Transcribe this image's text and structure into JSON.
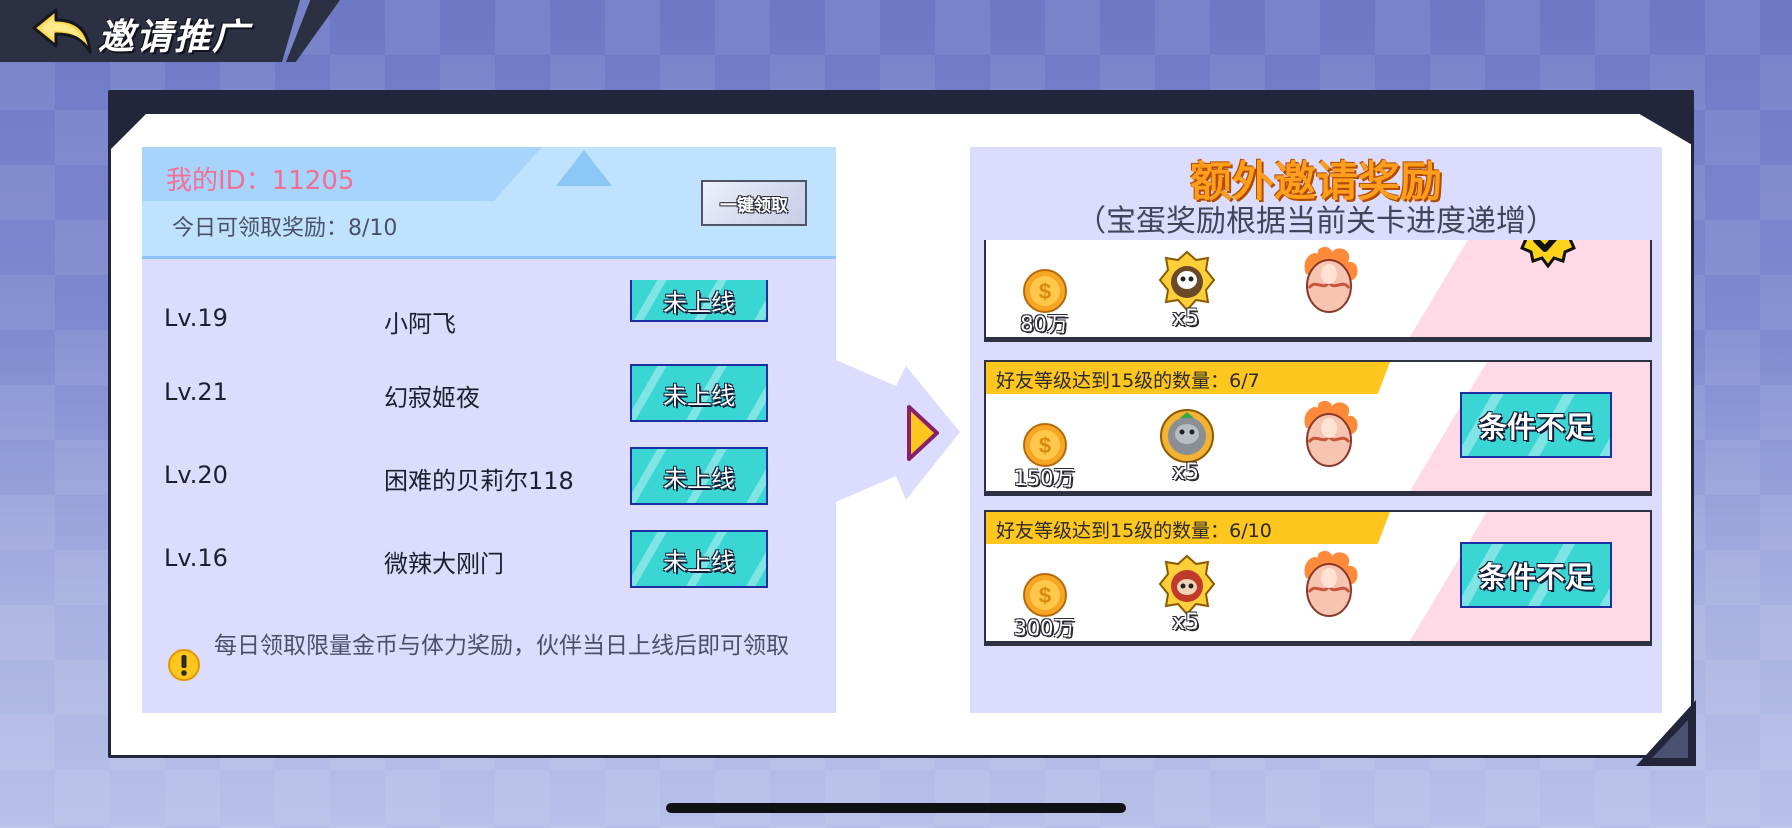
{
  "header": {
    "title": "邀请推广"
  },
  "left": {
    "my_id_label": "我的ID：11205",
    "today_reward": "今日可领取奖励：8/10",
    "claim_all_label": "一键领取",
    "friends": [
      {
        "level": "Lv.19",
        "name": "小阿飞",
        "status": "未上线"
      },
      {
        "level": "Lv.21",
        "name": "幻寂姬夜",
        "status": "未上线"
      },
      {
        "level": "Lv.20",
        "name": "困难的贝莉尔118",
        "status": "未上线"
      },
      {
        "level": "Lv.16",
        "name": "微辣大刚门",
        "status": "未上线"
      }
    ],
    "info_text": "每日领取限量金币与体力奖励，伙伴当日上线后即可领取"
  },
  "right": {
    "title": "额外邀请奖励",
    "subtitle": "（宝蛋奖励根据当前关卡进度递增）",
    "rewards": [
      {
        "requirement": "",
        "coins": "80万",
        "pet_count": "x5",
        "status": "claimed",
        "status_icon": "check-badge-icon"
      },
      {
        "requirement": "好友等级达到15级的数量：6/7",
        "coins": "150万",
        "pet_count": "x5",
        "status_label": "条件不足"
      },
      {
        "requirement": "好友等级达到15级的数量：6/10",
        "coins": "300万",
        "pet_count": "x5",
        "status_label": "条件不足"
      }
    ]
  },
  "colors": {
    "accent_cyan": "#3ad6d4",
    "title_orange": "#ff9d1c",
    "id_pink": "#f46f96",
    "panel_lavender": "#dcdcff",
    "banner_yellow": "#ffc61e"
  }
}
